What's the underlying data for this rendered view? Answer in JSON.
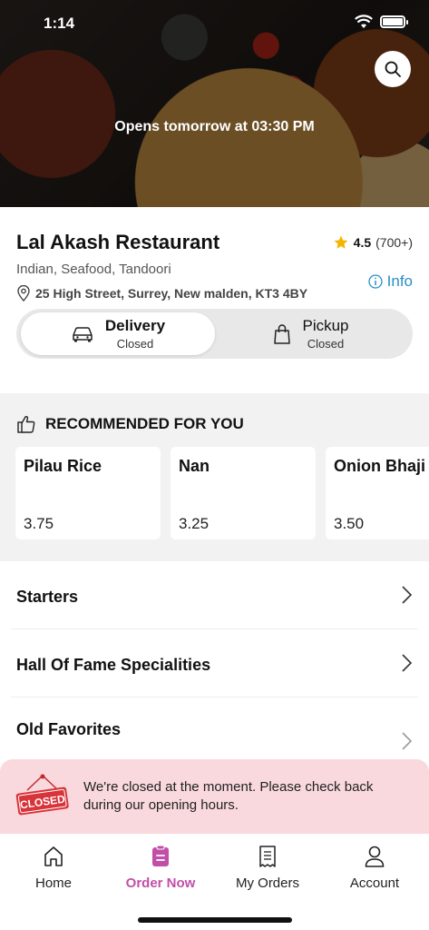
{
  "status_bar": {
    "time": "1:14"
  },
  "hero": {
    "opens_text": "Opens tomorrow at 03:30 PM"
  },
  "restaurant": {
    "name": "Lal Akash Restaurant",
    "rating": "4.5",
    "rating_count": "(700+)",
    "cuisines": "Indian, Seafood, Tandoori",
    "info_label": "Info",
    "address": "25 High Street, Surrey, New malden, KT3 4BY"
  },
  "order_type": {
    "delivery": {
      "label": "Delivery",
      "status": "Closed"
    },
    "pickup": {
      "label": "Pickup",
      "status": "Closed"
    }
  },
  "recommended": {
    "title": "RECOMMENDED FOR YOU",
    "items": [
      {
        "name": "Pilau Rice",
        "price": "3.75"
      },
      {
        "name": "Nan",
        "price": "3.25"
      },
      {
        "name": "Onion Bhaji",
        "price": "3.50"
      }
    ]
  },
  "menu": {
    "categories": [
      {
        "label": "Starters"
      },
      {
        "label": "Hall Of Fame Specialities"
      },
      {
        "label": "Old Favorites"
      }
    ]
  },
  "closed_banner": {
    "sign_text": "CLOSED",
    "message": "We're closed at the moment. Please check back during our opening hours."
  },
  "bottom_nav": {
    "items": [
      {
        "label": "Home",
        "icon": "home-icon"
      },
      {
        "label": "Order Now",
        "icon": "order-icon"
      },
      {
        "label": "My Orders",
        "icon": "receipt-icon"
      },
      {
        "label": "Account",
        "icon": "person-icon"
      }
    ]
  },
  "colors": {
    "accent": "#c14fa8",
    "info": "#2a8fc9",
    "banner_bg": "#f9d9dd",
    "closed_red": "#d8343a",
    "star": "#f4b400"
  }
}
